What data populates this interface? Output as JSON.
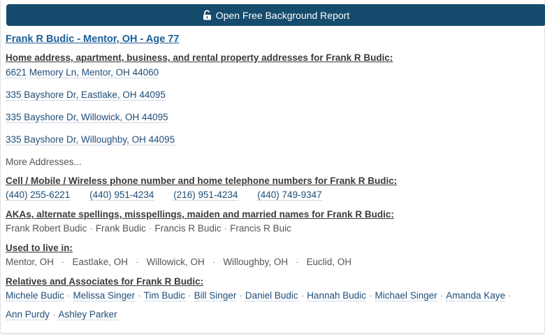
{
  "report_button": {
    "label": "Open Free Background Report"
  },
  "person_title": "Frank R Budic - Mentor, OH - Age 77",
  "addresses": {
    "heading": "Home address, apartment, business, and rental property addresses for Frank R Budic:",
    "items": [
      "6621 Memory Ln, Mentor, OH 44060",
      "335 Bayshore Dr, Eastlake, OH 44095",
      "335 Bayshore Dr, Willowick, OH 44095",
      "335 Bayshore Dr, Willoughby, OH 44095"
    ],
    "more_label": "More Addresses..."
  },
  "phones": {
    "heading": "Cell / Mobile / Wireless phone number and home telephone numbers for Frank R Budic:",
    "items": [
      "(440) 255-6221",
      "(440) 951-4234",
      "(216) 951-4234",
      "(440) 749-9347"
    ]
  },
  "akas": {
    "heading": "AKAs, alternate spellings, misspellings, maiden and married names for Frank R Budic:",
    "items": [
      "Frank Robert Budic",
      "Frank Budic",
      "Francis R Budic",
      "Francis R Buic"
    ]
  },
  "lived_in": {
    "heading": "Used to live in:",
    "items": [
      "Mentor, OH",
      "Eastlake, OH",
      "Willowick, OH",
      "Willoughby, OH",
      "Euclid, OH"
    ]
  },
  "relatives": {
    "heading": "Relatives and Associates for Frank R Budic:",
    "items": [
      "Michele Budic",
      "Melissa Singer",
      "Tim Budic",
      "Bill Singer",
      "Daniel Budic",
      "Hannah Budic",
      "Michael Singer",
      "Amanda Kaye",
      "Ann Purdy",
      "Ashley Parker"
    ]
  },
  "separator": "·",
  "colors": {
    "button_bg": "#154b6c",
    "link": "#1f4d78",
    "title_link": "#1d5f97"
  }
}
